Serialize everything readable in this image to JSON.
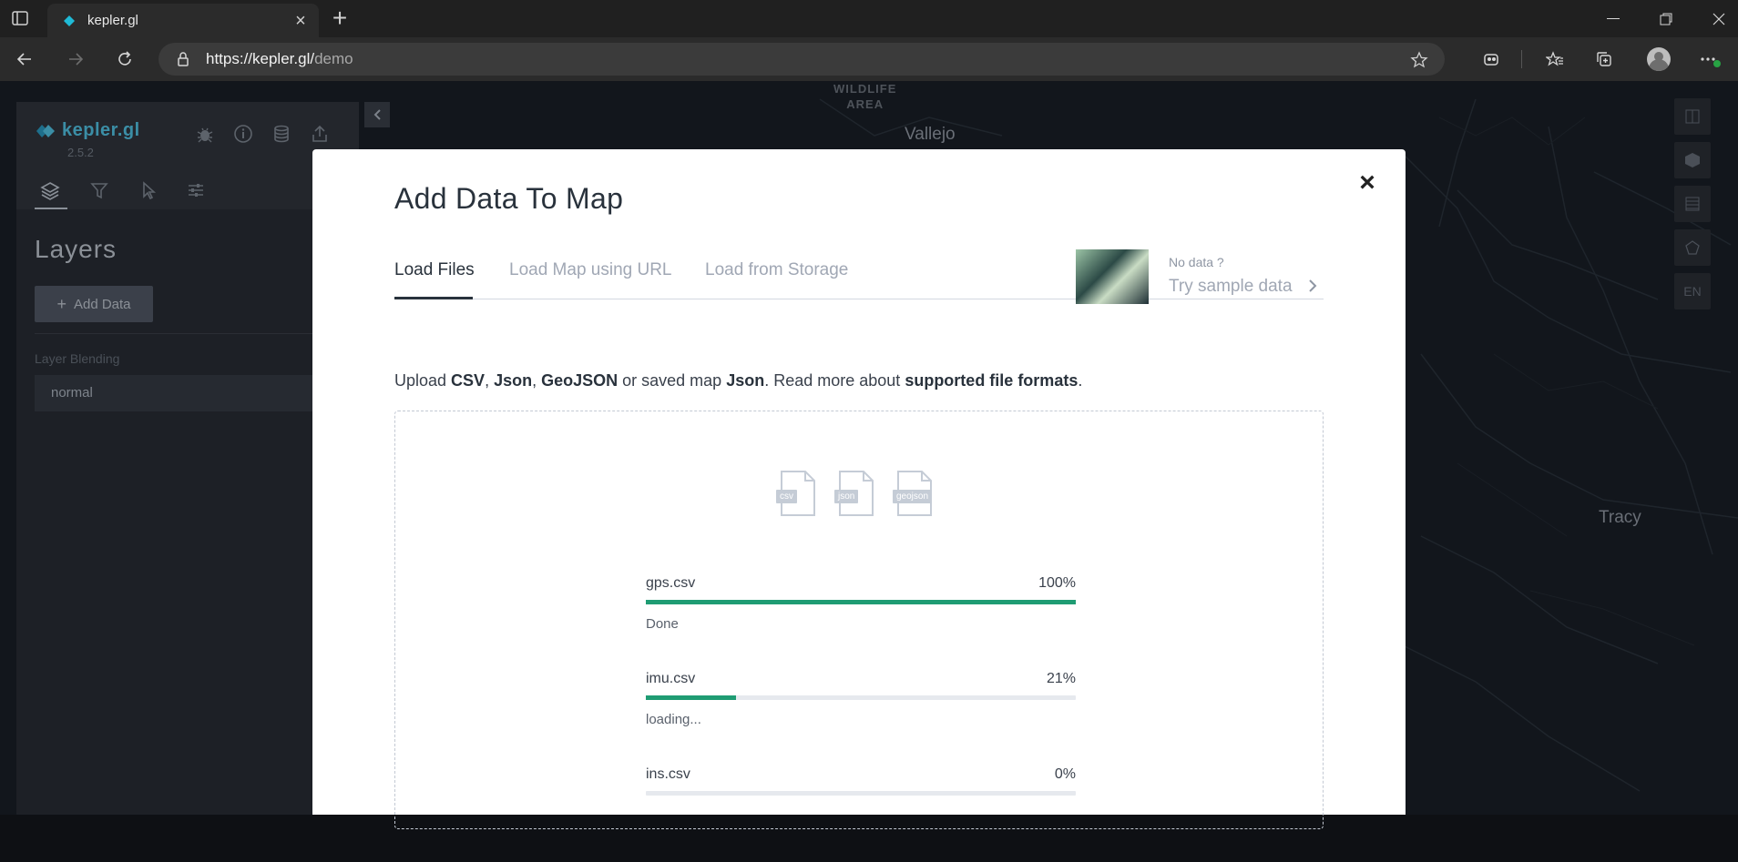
{
  "browser": {
    "tab_title": "kepler.gl",
    "url_host": "https://kepler.gl/",
    "url_path": "demo"
  },
  "map": {
    "labels": {
      "wildlife_1": "WILDLIFE",
      "wildlife_2": "AREA",
      "vallejo": "Vallejo",
      "tracy": "Tracy"
    },
    "lang": "EN"
  },
  "sidebar": {
    "app_name": "kepler.gl",
    "version": "2.5.2",
    "layers_title": "Layers",
    "add_data_label": "Add Data",
    "blending_label": "Layer Blending",
    "blending_value": "normal"
  },
  "modal": {
    "title": "Add Data To Map",
    "tabs": [
      {
        "label": "Load Files",
        "active": true
      },
      {
        "label": "Load Map using URL",
        "active": false
      },
      {
        "label": "Load from Storage",
        "active": false
      }
    ],
    "sample": {
      "no_data": "No data ?",
      "try_label": "Try sample data"
    },
    "upload": {
      "prefix": "Upload ",
      "csv": "CSV",
      "comma1": ", ",
      "json": "Json",
      "comma2": ", ",
      "geojson": "GeoJSON",
      "middle": " or saved map ",
      "json2": "Json",
      "suffix": ". Read more about ",
      "link": "supported file formats",
      "end": "."
    },
    "file_types": [
      "csv",
      "json",
      "geojson"
    ],
    "files": [
      {
        "name": "gps.csv",
        "percent_label": "100%",
        "progress": 1.0,
        "status": "Done"
      },
      {
        "name": "imu.csv",
        "percent_label": "21%",
        "progress": 0.21,
        "status": "loading..."
      },
      {
        "name": "ins.csv",
        "percent_label": "0%",
        "progress": 0.0,
        "status": ""
      }
    ]
  },
  "colors": {
    "progress": "#1f9c73",
    "brand": "#3b8ea6"
  }
}
